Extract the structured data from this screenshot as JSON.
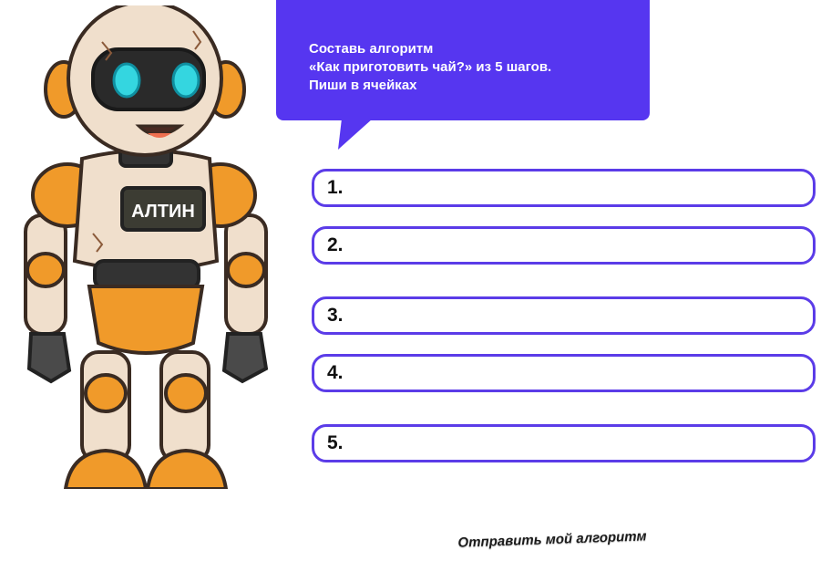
{
  "robot": {
    "badge_text": "АЛТИН"
  },
  "prompt": {
    "lines": [
      "Составь алгоритм",
      "«Как приготовить чай?» из 5 шагов.",
      "Пиши в ячейках"
    ]
  },
  "steps": [
    {
      "number": "1.",
      "value": ""
    },
    {
      "number": "2.",
      "value": ""
    },
    {
      "number": "3.",
      "value": ""
    },
    {
      "number": "4.",
      "value": ""
    },
    {
      "number": "5.",
      "value": ""
    }
  ],
  "submit_label": "Отправить мой алгоритм",
  "colors": {
    "accent": "#5636f0",
    "border": "#5b3ce8",
    "robot_orange": "#f09a2a",
    "robot_body": "#f0dfcc"
  }
}
